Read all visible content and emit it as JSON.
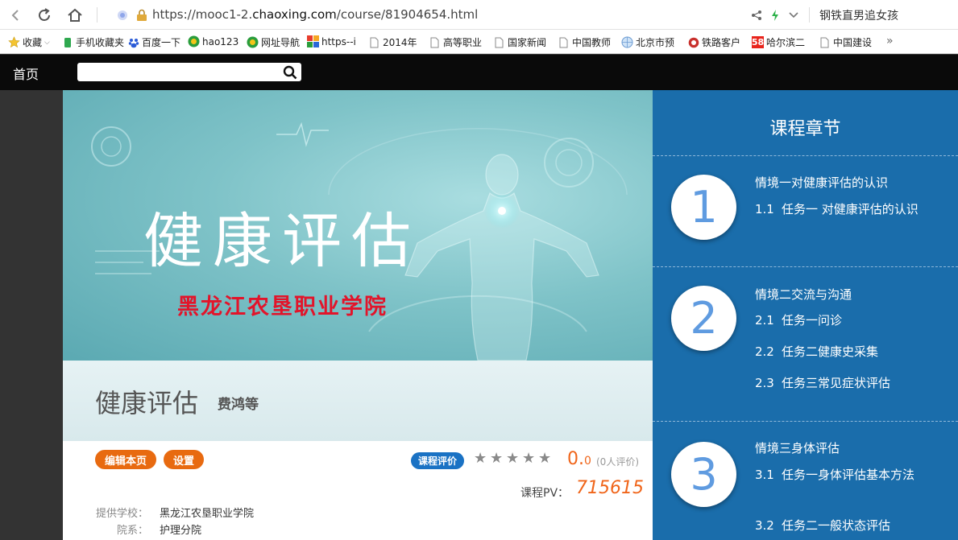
{
  "browser": {
    "url_prefix": "https://mooc1-2.",
    "url_domain": "chaoxing.com",
    "url_suffix": "/course/81904654.html",
    "tab_title": "钢铁直男追女孩"
  },
  "bookmarks": [
    {
      "label": "收藏",
      "icon": "star-icon"
    },
    {
      "label": "手机收藏夹",
      "icon": "phone-icon"
    },
    {
      "label": "百度一下",
      "icon": "baidu-icon"
    },
    {
      "label": "hao123",
      "icon": "hao123-icon"
    },
    {
      "label": "网址导航",
      "icon": "nav-icon"
    },
    {
      "label": "https--i",
      "icon": "site-icon"
    },
    {
      "label": "2014年",
      "icon": "page-icon"
    },
    {
      "label": "高等职业",
      "icon": "page-icon"
    },
    {
      "label": "国家新闻",
      "icon": "page-icon"
    },
    {
      "label": "中国教师",
      "icon": "page-icon"
    },
    {
      "label": "北京市预",
      "icon": "globe-icon"
    },
    {
      "label": "铁路客户",
      "icon": "rail-icon"
    },
    {
      "label": "哈尔滨二",
      "icon": "58-icon"
    },
    {
      "label": "中国建设",
      "icon": "page-icon"
    }
  ],
  "site": {
    "home_label": "首页",
    "search_placeholder": ""
  },
  "banner": {
    "title": "健康评估",
    "school": "黑龙江农垦职业学院"
  },
  "course": {
    "title": "健康评估",
    "authors": "费鸿等",
    "edit_label": "编辑本页",
    "settings_label": "设置",
    "eval_label": "课程评价",
    "rating": 0,
    "score_main": "0.",
    "score_decimal": "0",
    "rating_count": "(0人评价)",
    "pv_label": "课程PV：",
    "pv_value": "715615",
    "school_label": "提供学校：",
    "school_value": "黑龙江农垦职业学院",
    "dept_label": "院系：",
    "dept_value": "护理分院"
  },
  "chapters": {
    "header": "课程章节",
    "items": [
      {
        "num": "1",
        "title": "情境一对健康评估的认识",
        "sections": [
          {
            "n": "1.1",
            "t": "任务一 对健康评估的认识"
          }
        ]
      },
      {
        "num": "2",
        "title": "情境二交流与沟通",
        "sections": [
          {
            "n": "2.1",
            "t": "任务一问诊"
          },
          {
            "n": "2.2",
            "t": "任务二健康史采集"
          },
          {
            "n": "2.3",
            "t": "任务三常见症状评估"
          }
        ]
      },
      {
        "num": "3",
        "title": "情境三身体评估",
        "sections": [
          {
            "n": "3.1",
            "t": "任务一身体评估基本方法"
          },
          {
            "n": "3.2",
            "t": "任务二一般状态评估"
          }
        ]
      }
    ]
  }
}
